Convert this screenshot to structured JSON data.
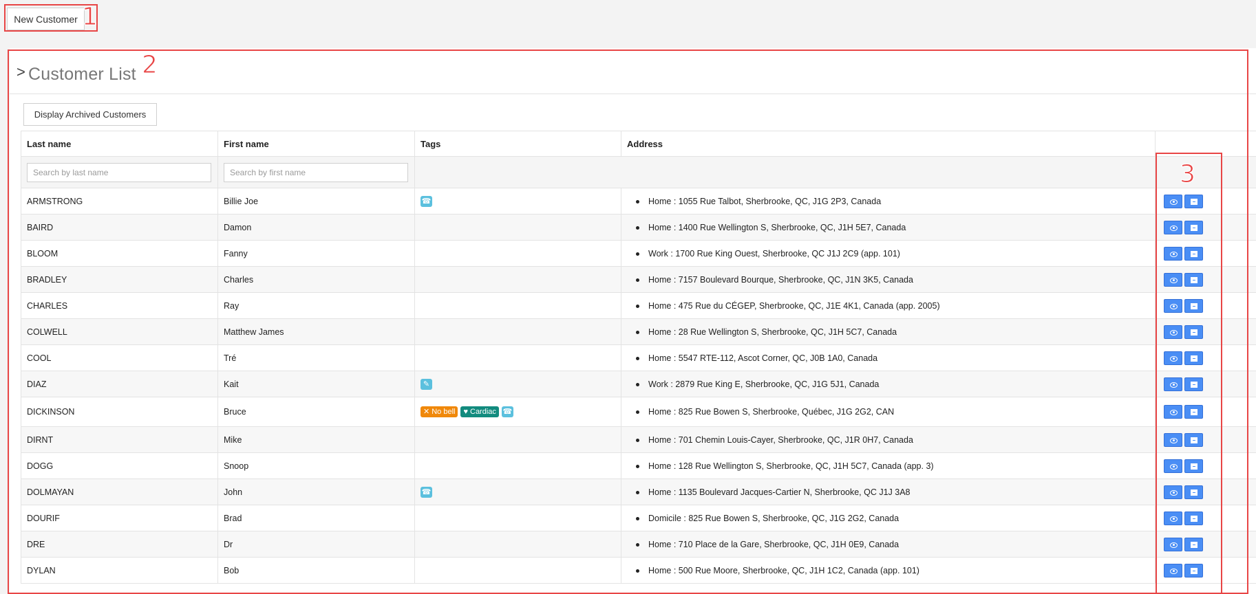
{
  "toolbar": {
    "new_customer_label": "New Customer"
  },
  "annotations": [
    "1",
    "2",
    "3"
  ],
  "panel": {
    "chevron": ">",
    "title": "Customer List",
    "archived_label": "Display Archived Customers"
  },
  "table": {
    "columns": [
      "Last name",
      "First name",
      "Tags",
      "Address"
    ],
    "search_last_placeholder": "Search by last name",
    "search_first_placeholder": "Search by first name",
    "rows": [
      {
        "last": "ARMSTRONG",
        "first": "Billie Joe",
        "address": "Home : 1055 Rue Talbot, Sherbrooke, QC, J1G 2P3, Canada"
      },
      {
        "last": "BAIRD",
        "first": "Damon",
        "address": "Home : 1400 Rue Wellington S, Sherbrooke, QC, J1H 5E7, Canada"
      },
      {
        "last": "BLOOM",
        "first": "Fanny",
        "address": "Work : 1700 Rue King Ouest, Sherbrooke, QC J1J 2C9 (app. 101)"
      },
      {
        "last": "BRADLEY",
        "first": "Charles",
        "address": "Home : 7157 Boulevard Bourque, Sherbrooke, QC, J1N 3K5, Canada"
      },
      {
        "last": "CHARLES",
        "first": "Ray",
        "address": "Home : 475 Rue du CÉGEP, Sherbrooke, QC, J1E 4K1, Canada (app. 2005)"
      },
      {
        "last": "COLWELL",
        "first": "Matthew James",
        "address": "Home : 28 Rue Wellington S, Sherbrooke, QC, J1H 5C7, Canada"
      },
      {
        "last": "COOL",
        "first": "Tré",
        "address": "Home : 5547 RTE-112, Ascot Corner, QC, J0B 1A0, Canada"
      },
      {
        "last": "DIAZ",
        "first": "Kait",
        "address": "Work : 2879 Rue King E, Sherbrooke, QC, J1G 5J1, Canada"
      },
      {
        "last": "DICKINSON",
        "first": "Bruce",
        "address": "Home : 825 Rue Bowen S, Sherbrooke, Québec, J1G 2G2, CAN"
      },
      {
        "last": "DIRNT",
        "first": "Mike",
        "address": "Home : 701 Chemin Louis-Cayer, Sherbrooke, QC, J1R 0H7, Canada"
      },
      {
        "last": "DOGG",
        "first": "Snoop",
        "address": "Home : 128 Rue Wellington S, Sherbrooke, QC, J1H 5C7, Canada (app. 3)"
      },
      {
        "last": "DOLMAYAN",
        "first": "John",
        "address": "Home : 1135 Boulevard Jacques-Cartier N, Sherbrooke, QC J1J 3A8"
      },
      {
        "last": "DOURIF",
        "first": "Brad",
        "address": "Domicile : 825 Rue Bowen S, Sherbrooke, QC, J1G 2G2, Canada"
      },
      {
        "last": "DRE",
        "first": "Dr",
        "address": "Home : 710 Place de la Gare, Sherbrooke, QC, J1H 0E9, Canada"
      },
      {
        "last": "DYLAN",
        "first": "Bob",
        "address": "Home : 500 Rue Moore, Sherbrooke, QC, J1H 1C2, Canada (app. 101)"
      }
    ],
    "tags": {
      "no_bell": "No bell",
      "cardiac": "Cardiac"
    }
  },
  "icons": {
    "phone": "phone-icon",
    "edit": "edit-icon",
    "bell_slash": "bell-slash-icon",
    "heartbeat": "heartbeat-icon",
    "view": "eye-icon",
    "archive": "archive-icon"
  },
  "colors": {
    "annotation": "#e84545",
    "action_button": "#4a8ef5",
    "tag_info": "#5bc0de",
    "tag_warning": "#f0880a",
    "tag_teal": "#128b7e"
  }
}
